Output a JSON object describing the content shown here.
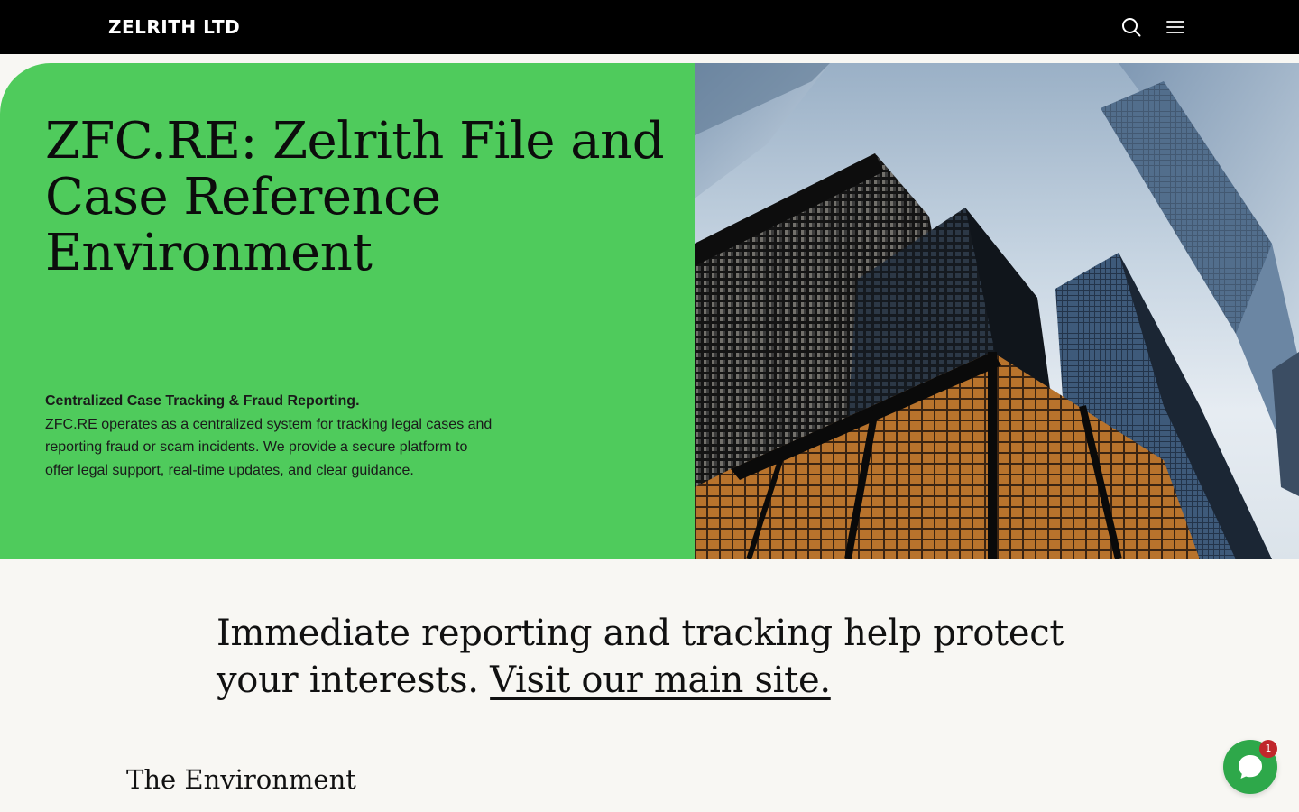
{
  "header": {
    "brand": "ZELRITH LTD",
    "search_icon": "search-icon",
    "menu_icon": "hamburger-menu-icon"
  },
  "hero": {
    "title": "ZFC.RE: Zelrith File and Case Reference Environment",
    "lead": "Centralized Case Tracking & Fraud Reporting.",
    "body": "ZFC.RE operates as a centralized system for tracking legal cases and reporting fraud or scam incidents. We provide a secure platform to offer legal support, real-time updates, and clear guidance.",
    "image": "skyscrapers-photo",
    "accent_color": "#4fcb5c"
  },
  "statement": {
    "text": "Immediate reporting and tracking help protect your interests. ",
    "link_label": "Visit our main site."
  },
  "section": {
    "title": "The Environment"
  },
  "chat": {
    "icon": "chat-bubble-icon",
    "badge_count": "1",
    "color": "#2ea84a"
  }
}
